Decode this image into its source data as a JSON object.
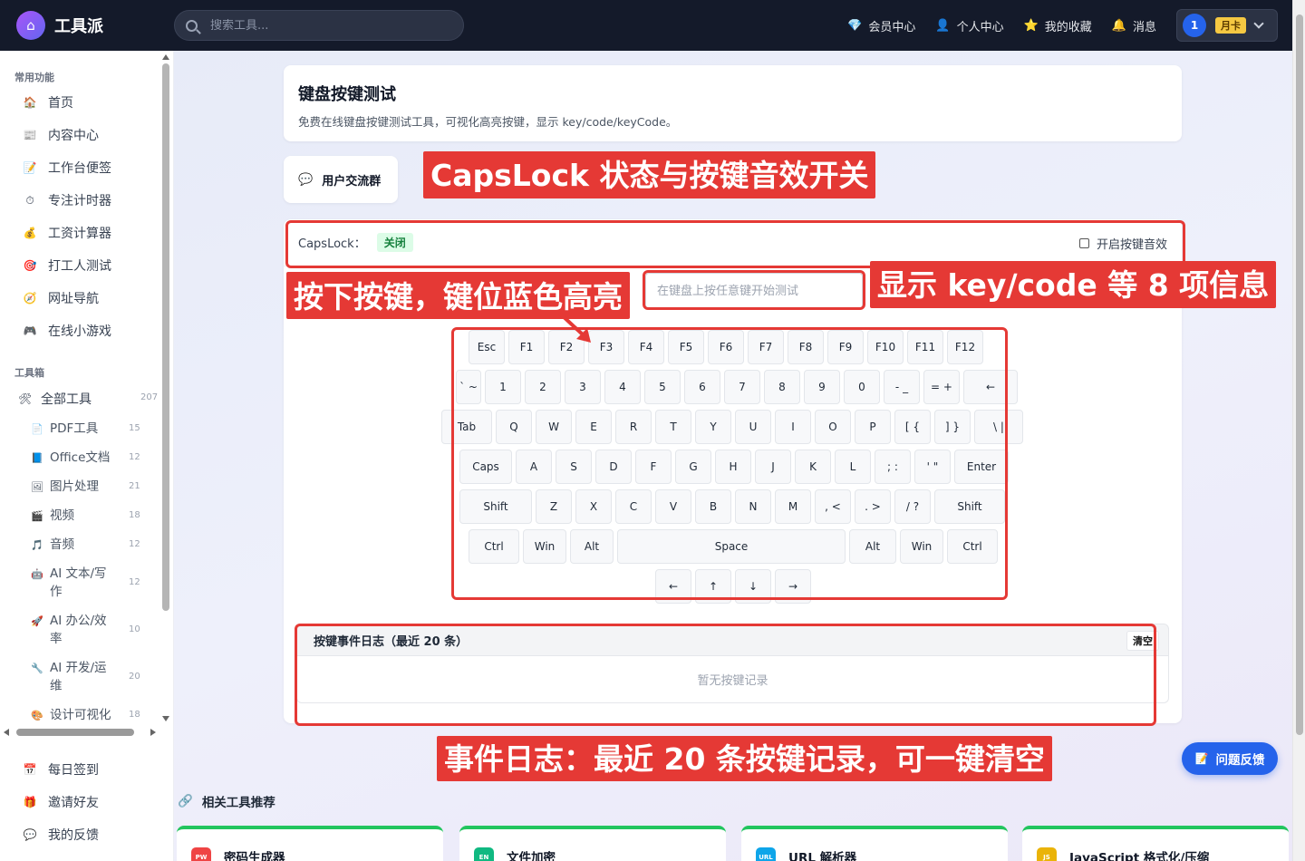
{
  "topbar": {
    "app_name": "工具派",
    "search_placeholder": "搜索工具...",
    "nav": [
      {
        "icon": "💎",
        "label": "会员中心"
      },
      {
        "icon": "👤",
        "label": "个人中心"
      },
      {
        "icon": "⭐",
        "label": "我的收藏"
      },
      {
        "icon": "🔔",
        "label": "消息"
      }
    ],
    "user": {
      "avatar_text": "1",
      "badge": "月卡"
    }
  },
  "sidebar": {
    "common_title": "常用功能",
    "common_items": [
      {
        "icon": "🏠",
        "label": "首页"
      },
      {
        "icon": "📰",
        "label": "内容中心"
      },
      {
        "icon": "📝",
        "label": "工作台便签"
      },
      {
        "icon": "⏱",
        "label": "专注计时器"
      },
      {
        "icon": "💰",
        "label": "工资计算器"
      },
      {
        "icon": "🎯",
        "label": "打工人测试"
      },
      {
        "icon": "🧭",
        "label": "网址导航"
      },
      {
        "icon": "🎮",
        "label": "在线小游戏"
      }
    ],
    "toolbox_title": "工具箱",
    "all_tools": {
      "icon": "🛠",
      "label": "全部工具",
      "count": "207"
    },
    "categories": [
      {
        "icon": "📄",
        "label": "PDF工具",
        "count": "15"
      },
      {
        "icon": "📘",
        "label": "Office文档",
        "count": "12"
      },
      {
        "icon": "🖼",
        "label": "图片处理",
        "count": "21"
      },
      {
        "icon": "🎬",
        "label": "视频",
        "count": "18"
      },
      {
        "icon": "🎵",
        "label": "音频",
        "count": "12"
      },
      {
        "icon": "🤖",
        "label": "AI 文本/写作",
        "count": "12"
      },
      {
        "icon": "🚀",
        "label": "AI 办公/效率",
        "count": "10"
      },
      {
        "icon": "🔧",
        "label": "AI 开发/运维",
        "count": "20"
      },
      {
        "icon": "🎨",
        "label": "设计可视化",
        "count": "18"
      }
    ],
    "bottom_items": [
      {
        "icon": "📅",
        "label": "每日签到"
      },
      {
        "icon": "🎁",
        "label": "邀请好友"
      },
      {
        "icon": "💬",
        "label": "我的反馈"
      }
    ]
  },
  "page": {
    "title": "键盘按键测试",
    "description": "免费在线键盘按键测试工具，可视化高亮按键，显示 key/code/keyCode。",
    "group_label": "用户交流群",
    "capslock_label": "CapsLock：",
    "capslock_state": "关闭",
    "sound_label": "开启按键音效",
    "input_placeholder": "在键盘上按任意键开始测试",
    "log_title": "按键事件日志（最近 20 条）",
    "log_clear": "清空",
    "log_empty": "暂无按键记录"
  },
  "keyboard": {
    "rows": [
      [
        "Esc",
        "F1",
        "F2",
        "F3",
        "F4",
        "F5",
        "F6",
        "F7",
        "F8",
        "F9",
        "F10",
        "F11",
        "F12"
      ],
      [
        "` ~",
        "1",
        "2",
        "3",
        "4",
        "5",
        "6",
        "7",
        "8",
        "9",
        "0",
        "- _",
        "= +",
        "←"
      ],
      [
        "Tab",
        "Q",
        "W",
        "E",
        "R",
        "T",
        "Y",
        "U",
        "I",
        "O",
        "P",
        "[ {",
        "] }",
        "\\ |"
      ],
      [
        "Caps",
        "A",
        "S",
        "D",
        "F",
        "G",
        "H",
        "J",
        "K",
        "L",
        "; :",
        "' \"",
        "Enter"
      ],
      [
        "Shift",
        "Z",
        "X",
        "C",
        "V",
        "B",
        "N",
        "M",
        ", <",
        ". >",
        "/ ?",
        "Shift"
      ],
      [
        "Ctrl",
        "Win",
        "Alt",
        "Space",
        "Alt",
        "Win",
        "Ctrl"
      ],
      [
        "←",
        "↑",
        "↓",
        "→"
      ]
    ]
  },
  "annotations": {
    "caps_note": "CapsLock 状态与按键音效开关",
    "press_note": "按下按键，键位蓝色高亮",
    "info_note": "显示 key/code 等 8 项信息",
    "log_note": "事件日志：最近 20 条按键记录，可一键清空",
    "color": "#e53935"
  },
  "feedback": {
    "icon": "📝",
    "label": "问题反馈"
  },
  "related": {
    "title": "相关工具推荐",
    "items": [
      {
        "badge": "PW",
        "color": "#ef4444",
        "label": "密码生成器"
      },
      {
        "badge": "EN",
        "color": "#10b981",
        "label": "文件加密"
      },
      {
        "badge": "URL",
        "color": "#0ea5e9",
        "label": "URL 解析器"
      },
      {
        "badge": "JS",
        "color": "#eab308",
        "label": "JavaScript 格式化/压缩"
      }
    ]
  }
}
